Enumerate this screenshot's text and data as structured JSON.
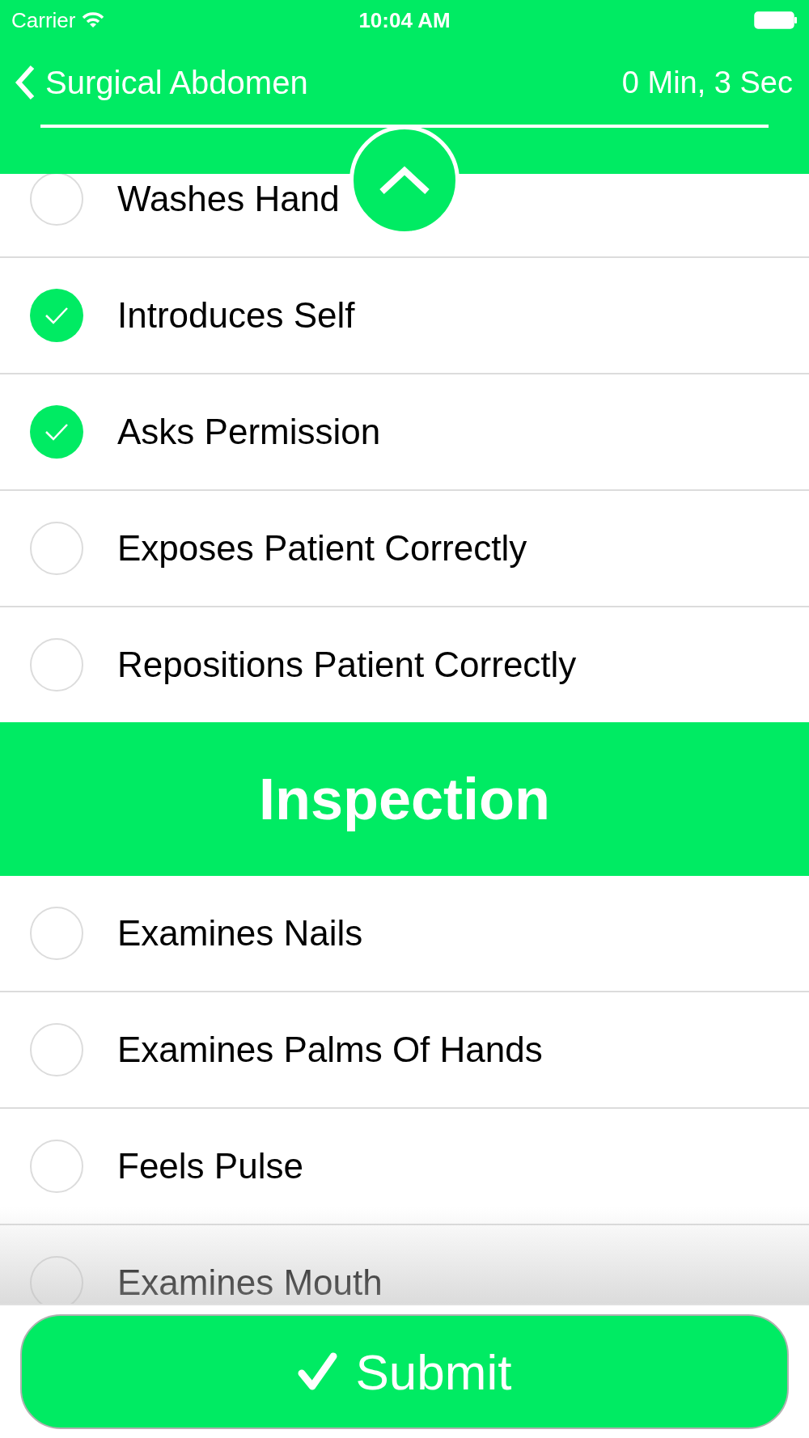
{
  "status_bar": {
    "carrier": "Carrier",
    "time": "10:04 AM"
  },
  "nav": {
    "title": "Surgical Abdomen",
    "timer": "0 Min, 3 Sec"
  },
  "sections": [
    {
      "kind": "list",
      "items": [
        {
          "label": "Washes Hand",
          "checked": false
        },
        {
          "label": "Introduces Self",
          "checked": true
        },
        {
          "label": "Asks Permission",
          "checked": true
        },
        {
          "label": "Exposes Patient Correctly",
          "checked": false
        },
        {
          "label": "Repositions Patient Correctly",
          "checked": false
        }
      ]
    },
    {
      "kind": "header",
      "title": "Inspection"
    },
    {
      "kind": "list",
      "items": [
        {
          "label": "Examines Nails",
          "checked": false
        },
        {
          "label": "Examines Palms Of Hands",
          "checked": false
        },
        {
          "label": "Feels Pulse",
          "checked": false
        },
        {
          "label": "Examines Mouth",
          "checked": false
        }
      ]
    }
  ],
  "submit": {
    "label": "Submit"
  }
}
